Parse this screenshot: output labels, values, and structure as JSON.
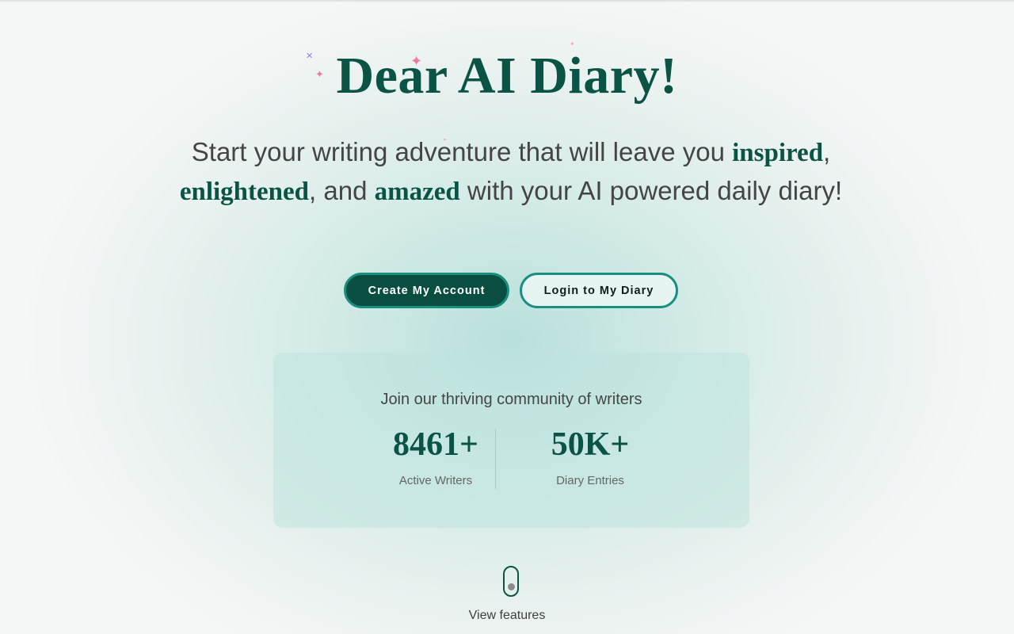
{
  "hero": {
    "title": "Dear AI Diary!",
    "tagline": {
      "part1": "Start your writing adventure that will leave you ",
      "highlight1": "inspired",
      "part2": ",",
      "highlight2": "enlightened",
      "part3": ", and ",
      "highlight3": "amazed",
      "part4": " with your AI powered daily diary!"
    },
    "decorations": [
      "sparkle-icon",
      "sparkle-icon",
      "cross-icon",
      "sparkle-icon",
      "dot-icon"
    ]
  },
  "actions": {
    "create_account_label": "Create My Account",
    "login_label": "Login to My Diary"
  },
  "stats": {
    "heading": "Join our thriving community of writers",
    "items": [
      {
        "value": "8461+",
        "label": "Active Writers"
      },
      {
        "value": "50K+",
        "label": "Diary Entries"
      }
    ]
  },
  "scroll": {
    "label": "View features",
    "icon": "mouse-scroll-icon"
  },
  "colors": {
    "brand_dark": "#0b5445",
    "button_primary_bg": "#0a4e42",
    "button_border": "#1a8f80",
    "sparkle_pink": "#f07aa6",
    "sparkle_purple": "#8a7ee0"
  }
}
